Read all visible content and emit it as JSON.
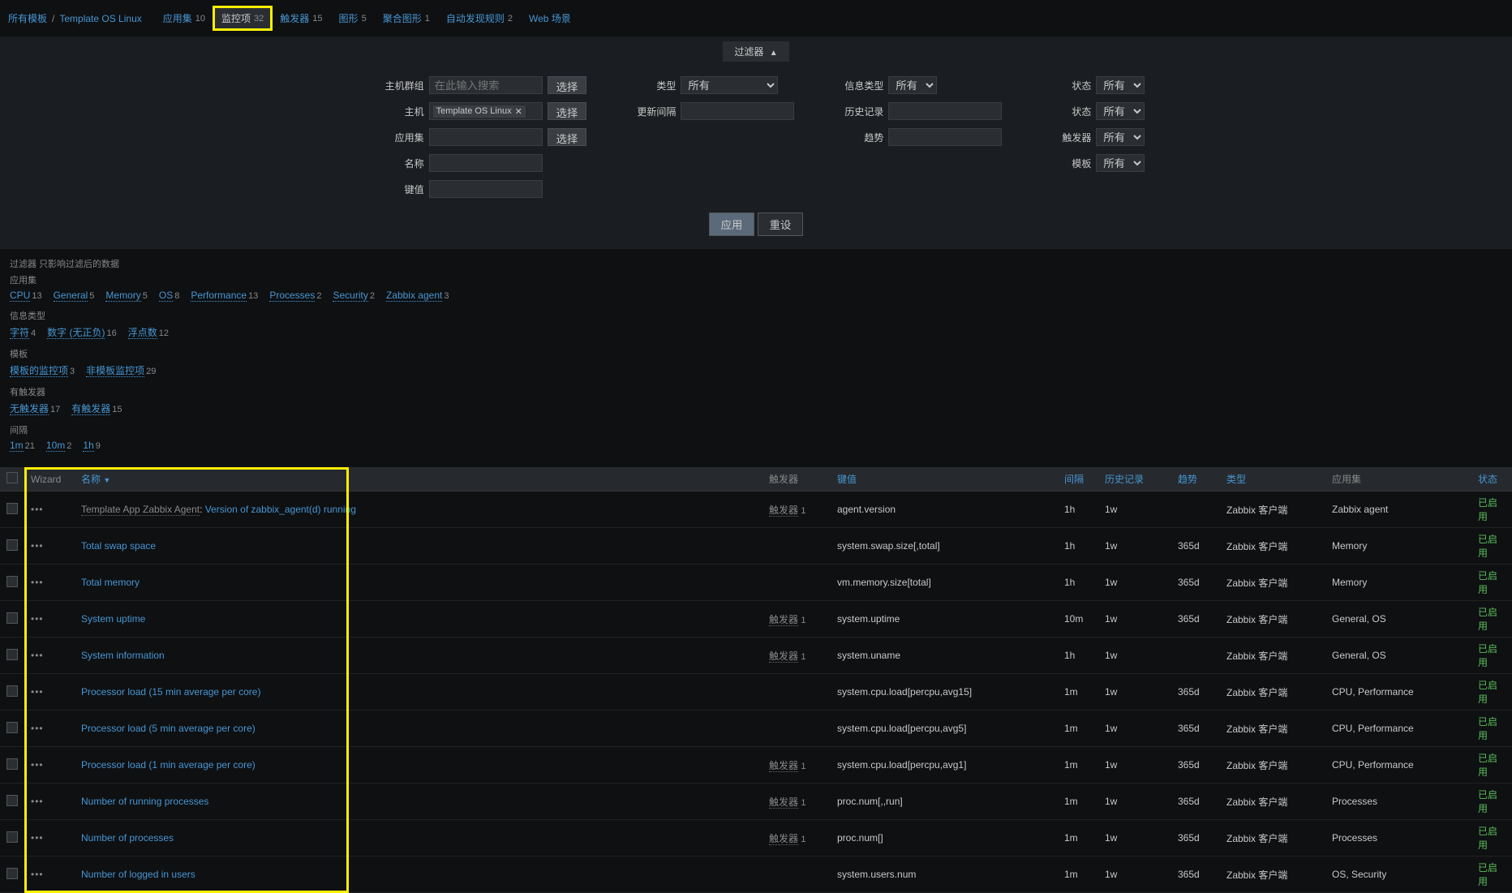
{
  "breadcrumb": {
    "all_templates": "所有模板",
    "template_name": "Template OS Linux",
    "tabs": [
      {
        "label": "应用集",
        "count": "10"
      },
      {
        "label": "监控项",
        "count": "32",
        "active": true,
        "highlight": true
      },
      {
        "label": "触发器",
        "count": "15"
      },
      {
        "label": "图形",
        "count": "5"
      },
      {
        "label": "聚合图形",
        "count": "1"
      },
      {
        "label": "自动发现规则",
        "count": "2"
      },
      {
        "label": "Web 场景",
        "count": ""
      }
    ]
  },
  "filter_toggle": "过滤器",
  "filter": {
    "labels": {
      "host_group": "主机群组",
      "host": "主机",
      "application": "应用集",
      "name": "名称",
      "key": "键值",
      "type": "类型",
      "update_interval": "更新间隔",
      "history": "历史记录",
      "trends": "趋势",
      "info_type": "信息类型",
      "state": "状态",
      "status": "状态",
      "triggers": "触发器",
      "template": "模板"
    },
    "placeholder_search": "在此输入搜索",
    "host_tag": "Template OS Linux",
    "select_btn": "选择",
    "all_option": "所有",
    "apply_btn": "应用",
    "reset_btn": "重设"
  },
  "subfilter": {
    "title": "过滤器",
    "subtitle": "只影响过滤后的数据",
    "groups": [
      {
        "label": "应用集",
        "items": [
          {
            "name": "CPU",
            "count": "13"
          },
          {
            "name": "General",
            "count": "5"
          },
          {
            "name": "Memory",
            "count": "5"
          },
          {
            "name": "OS",
            "count": "8"
          },
          {
            "name": "Performance",
            "count": "13"
          },
          {
            "name": "Processes",
            "count": "2"
          },
          {
            "name": "Security",
            "count": "2"
          },
          {
            "name": "Zabbix agent",
            "count": "3"
          }
        ]
      },
      {
        "label": "信息类型",
        "items": [
          {
            "name": "字符",
            "count": "4"
          },
          {
            "name": "数字 (无正负)",
            "count": "16"
          },
          {
            "name": "浮点数",
            "count": "12"
          }
        ]
      },
      {
        "label": "模板",
        "items": [
          {
            "name": "模板的监控项",
            "count": "3"
          },
          {
            "name": "非模板监控项",
            "count": "29"
          }
        ]
      },
      {
        "label": "有触发器",
        "items": [
          {
            "name": "无触发器",
            "count": "17"
          },
          {
            "name": "有触发器",
            "count": "15"
          }
        ]
      },
      {
        "label": "间隔",
        "items": [
          {
            "name": "1m",
            "count": "21"
          },
          {
            "name": "10m",
            "count": "2"
          },
          {
            "name": "1h",
            "count": "9"
          }
        ]
      }
    ]
  },
  "table": {
    "headers": {
      "wizard": "Wizard",
      "name": "名称",
      "triggers": "触发器",
      "key": "键值",
      "interval": "间隔",
      "history": "历史记录",
      "trends": "趋势",
      "type": "类型",
      "applications": "应用集",
      "status": "状态"
    },
    "trigger_label": "触发器",
    "status_enabled": "已启用",
    "rows": [
      {
        "prefix": "Template App Zabbix Agent",
        "name": "Version of zabbix_agent(d) running",
        "trigger": "1",
        "key": "agent.version",
        "interval": "1h",
        "history": "1w",
        "trends": "",
        "type": "Zabbix 客户端",
        "apps": "Zabbix agent"
      },
      {
        "name": "Total swap space",
        "key": "system.swap.size[,total]",
        "interval": "1h",
        "history": "1w",
        "trends": "365d",
        "type": "Zabbix 客户端",
        "apps": "Memory"
      },
      {
        "name": "Total memory",
        "key": "vm.memory.size[total]",
        "interval": "1h",
        "history": "1w",
        "trends": "365d",
        "type": "Zabbix 客户端",
        "apps": "Memory"
      },
      {
        "name": "System uptime",
        "trigger": "1",
        "key": "system.uptime",
        "interval": "10m",
        "history": "1w",
        "trends": "365d",
        "type": "Zabbix 客户端",
        "apps": "General, OS"
      },
      {
        "name": "System information",
        "trigger": "1",
        "key": "system.uname",
        "interval": "1h",
        "history": "1w",
        "trends": "",
        "type": "Zabbix 客户端",
        "apps": "General, OS"
      },
      {
        "name": "Processor load (15 min average per core)",
        "key": "system.cpu.load[percpu,avg15]",
        "interval": "1m",
        "history": "1w",
        "trends": "365d",
        "type": "Zabbix 客户端",
        "apps": "CPU, Performance"
      },
      {
        "name": "Processor load (5 min average per core)",
        "key": "system.cpu.load[percpu,avg5]",
        "interval": "1m",
        "history": "1w",
        "trends": "365d",
        "type": "Zabbix 客户端",
        "apps": "CPU, Performance"
      },
      {
        "name": "Processor load (1 min average per core)",
        "trigger": "1",
        "key": "system.cpu.load[percpu,avg1]",
        "interval": "1m",
        "history": "1w",
        "trends": "365d",
        "type": "Zabbix 客户端",
        "apps": "CPU, Performance"
      },
      {
        "name": "Number of running processes",
        "trigger": "1",
        "key": "proc.num[,,run]",
        "interval": "1m",
        "history": "1w",
        "trends": "365d",
        "type": "Zabbix 客户端",
        "apps": "Processes"
      },
      {
        "name": "Number of processes",
        "trigger": "1",
        "key": "proc.num[]",
        "interval": "1m",
        "history": "1w",
        "trends": "365d",
        "type": "Zabbix 客户端",
        "apps": "Processes"
      },
      {
        "name": "Number of logged in users",
        "key": "system.users.num",
        "interval": "1m",
        "history": "1w",
        "trends": "365d",
        "type": "Zabbix 客户端",
        "apps": "OS, Security"
      }
    ]
  }
}
